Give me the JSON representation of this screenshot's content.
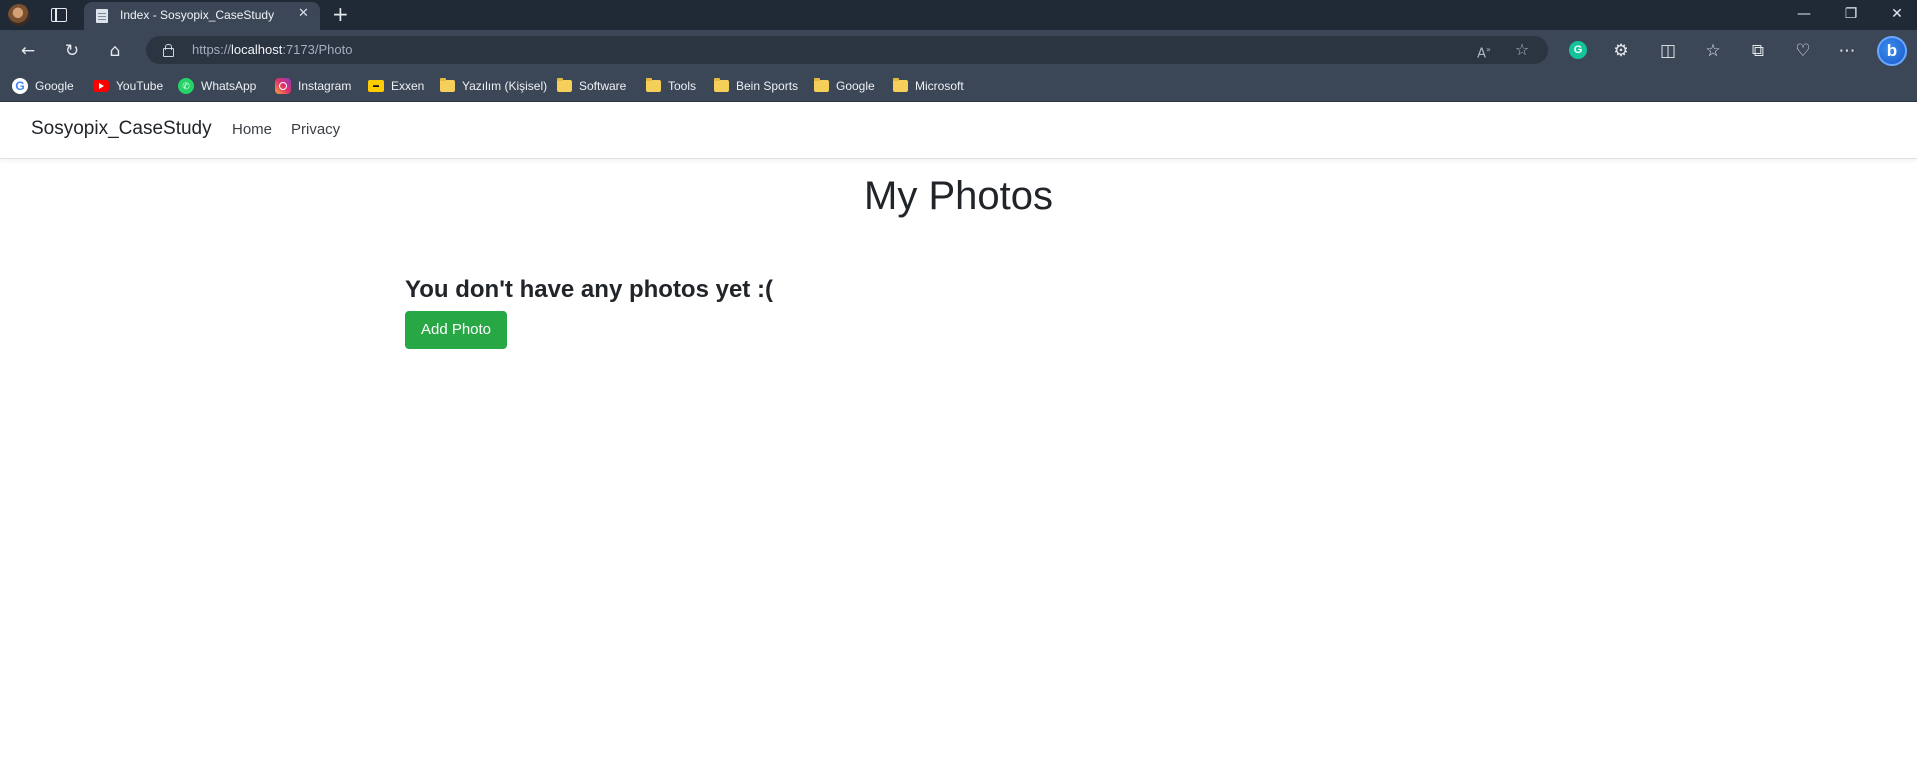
{
  "browser": {
    "tab_title": "Index - Sosyopix_CaseStudy",
    "url": {
      "scheme": "https://",
      "host": "localhost",
      "path": ":7173/Photo"
    },
    "window_controls": {
      "minimize": "—",
      "restore": "❐",
      "close": "✕"
    },
    "bookmarks": [
      {
        "label": "Google",
        "icon": "google-icon",
        "color": "#4285f4"
      },
      {
        "label": "YouTube",
        "icon": "youtube-icon",
        "color": "#ff0000"
      },
      {
        "label": "WhatsApp",
        "icon": "whatsapp-icon",
        "color": "#25d366"
      },
      {
        "label": "Instagram",
        "icon": "instagram-icon",
        "color": "#e1306c"
      },
      {
        "label": "Exxen",
        "icon": "exxen-icon",
        "color": "#ffcc00"
      },
      {
        "label": "Yazılım (Kişisel)",
        "icon": "folder-icon"
      },
      {
        "label": "Software",
        "icon": "folder-icon"
      },
      {
        "label": "Tools",
        "icon": "folder-icon"
      },
      {
        "label": "Bein Sports",
        "icon": "folder-icon"
      },
      {
        "label": "Google",
        "icon": "folder-icon"
      },
      {
        "label": "Microsoft",
        "icon": "folder-icon"
      }
    ]
  },
  "site": {
    "brand": "Sosyopix_CaseStudy",
    "nav": [
      {
        "label": "Home"
      },
      {
        "label": "Privacy"
      }
    ]
  },
  "main": {
    "title": "My Photos",
    "empty_message": "You don't have any photos yet :(",
    "add_button_label": "Add Photo"
  },
  "colors": {
    "primary_button": "#28a745",
    "chrome_dark": "#202a36",
    "chrome_toolbar": "#3b4656"
  }
}
